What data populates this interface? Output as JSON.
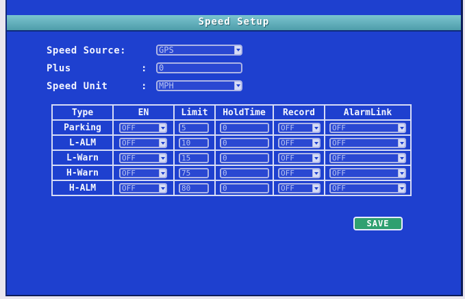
{
  "title": "Speed Setup",
  "speed_source": {
    "label": "Speed Source:",
    "value": "GPS"
  },
  "plus": {
    "label": "Plus",
    "colon": ":",
    "value": "0"
  },
  "speed_unit": {
    "label": "Speed Unit",
    "colon": ":",
    "value": "MPH"
  },
  "table": {
    "headers": [
      "Type",
      "EN",
      "Limit",
      "HoldTime",
      "Record",
      "AlarmLink"
    ],
    "rows": [
      {
        "type": "Parking",
        "en": "OFF",
        "limit": "5",
        "holdtime": "0",
        "record": "OFF",
        "alarmlink": "OFF"
      },
      {
        "type": "L-ALM",
        "en": "OFF",
        "limit": "10",
        "holdtime": "0",
        "record": "OFF",
        "alarmlink": "OFF"
      },
      {
        "type": "L-Warn",
        "en": "OFF",
        "limit": "15",
        "holdtime": "0",
        "record": "OFF",
        "alarmlink": "OFF"
      },
      {
        "type": "H-Warn",
        "en": "OFF",
        "limit": "75",
        "holdtime": "0",
        "record": "OFF",
        "alarmlink": "OFF"
      },
      {
        "type": "H-ALM",
        "en": "OFF",
        "limit": "80",
        "holdtime": "0",
        "record": "OFF",
        "alarmlink": "OFF"
      }
    ]
  },
  "save_label": "SAVE",
  "colors": {
    "background": "#1e40cf",
    "titlebar": "#6ab3bf",
    "save": "#2fa070"
  }
}
